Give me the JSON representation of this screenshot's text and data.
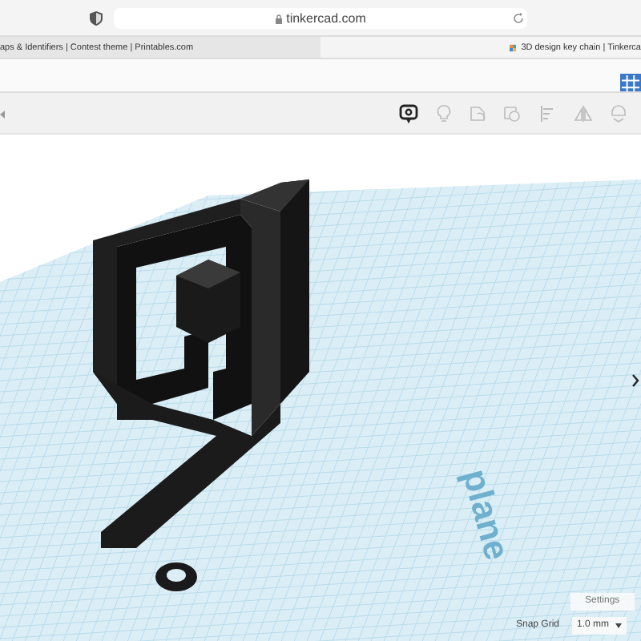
{
  "browser": {
    "address": "tinkercad.com",
    "tabs": [
      {
        "label": "aps & Identifiers | Contest theme | Printables.com",
        "selected": false
      },
      {
        "label": "3D design key chain | Tinkerca",
        "selected": true
      }
    ]
  },
  "toolbar": {
    "tools": [
      {
        "kind": "note",
        "disabled": false
      },
      {
        "kind": "bulb",
        "disabled": true
      },
      {
        "kind": "group",
        "disabled": true
      },
      {
        "kind": "ungroup",
        "disabled": true
      },
      {
        "kind": "align",
        "disabled": true
      },
      {
        "kind": "mirror",
        "disabled": true
      },
      {
        "kind": "cruise",
        "disabled": true
      }
    ]
  },
  "workplane": {
    "label": "plane",
    "settings_button": "Settings",
    "snap_grid": {
      "label": "Snap Grid",
      "value": "1.0 mm"
    }
  }
}
